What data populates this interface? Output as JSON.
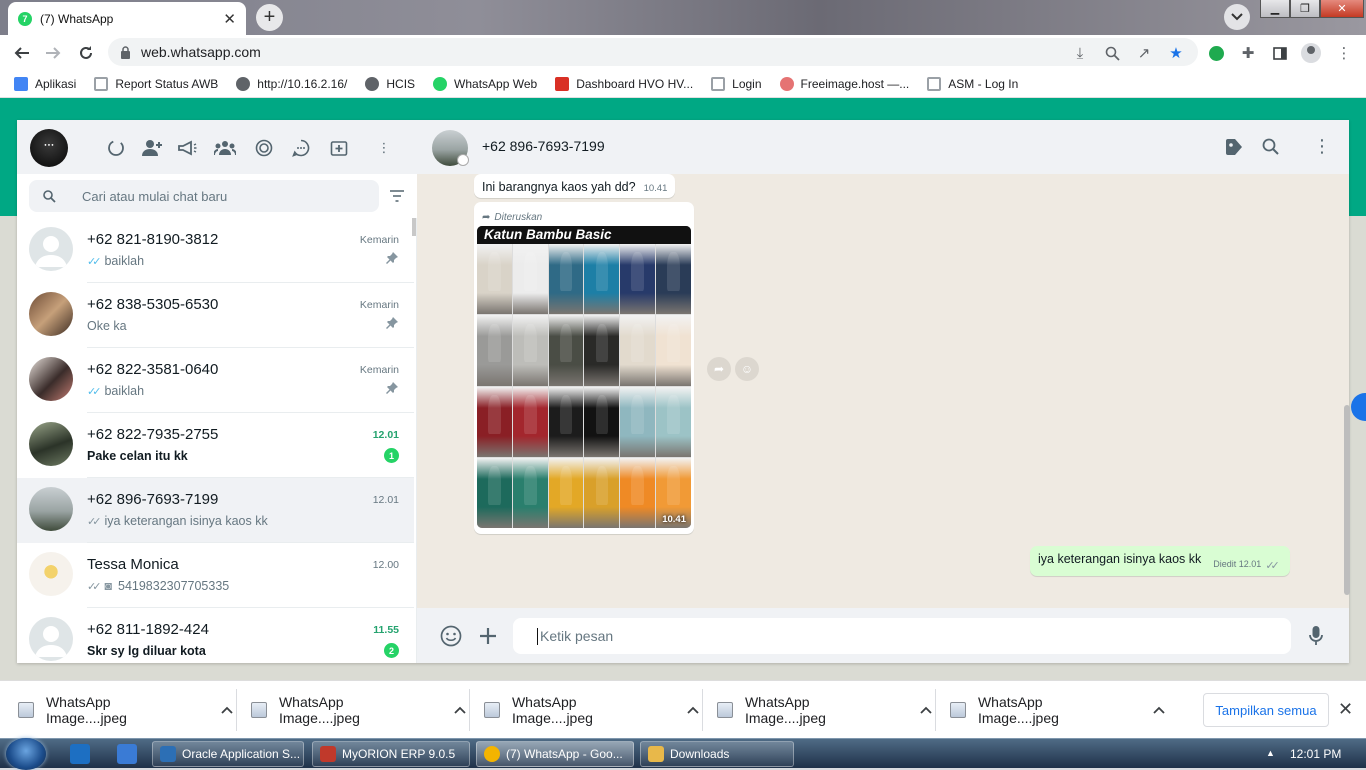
{
  "browser": {
    "tab_title": "(7) WhatsApp",
    "address": "web.whatsapp.com",
    "bookmarks": [
      {
        "label": "Aplikasi",
        "icon": "apps-grid-icon",
        "color": "#4285f4"
      },
      {
        "label": "Report Status AWB",
        "icon": "page-icon",
        "color": "#9aa0a6"
      },
      {
        "label": "http://10.16.2.16/",
        "icon": "globe-icon",
        "color": "#5f6368"
      },
      {
        "label": "HCIS",
        "icon": "globe-icon",
        "color": "#5f6368"
      },
      {
        "label": "WhatsApp Web",
        "icon": "whatsapp-icon",
        "color": "#25d366"
      },
      {
        "label": "Dashboard HVO HV...",
        "icon": "red-doc-icon",
        "color": "#d93025"
      },
      {
        "label": "Login",
        "icon": "page-icon",
        "color": "#9aa0a6"
      },
      {
        "label": "Freeimage.host —...",
        "icon": "freeimage-icon",
        "color": "#e57373"
      },
      {
        "label": "ASM - Log In",
        "icon": "page-icon",
        "color": "#9aa0a6"
      }
    ]
  },
  "sidebar": {
    "search_placeholder": "Cari atau mulai chat baru",
    "chats": [
      {
        "name": "+62 821-8190-3812",
        "message": "baiklah",
        "time": "Kemarin",
        "tick": "blue",
        "pinned": true,
        "unread": "",
        "bold": false,
        "avatar": "default",
        "selected": false
      },
      {
        "name": "+62 838-5305-6530",
        "message": "Oke ka",
        "time": "Kemarin",
        "tick": "",
        "pinned": true,
        "unread": "",
        "bold": false,
        "avatar": "photo-a",
        "selected": false
      },
      {
        "name": "+62 822-3581-0640",
        "message": "baiklah",
        "time": "Kemarin",
        "tick": "blue",
        "pinned": true,
        "unread": "",
        "bold": false,
        "avatar": "photo-b",
        "selected": false
      },
      {
        "name": "+62 822-7935-2755",
        "message": "Pake celan itu kk",
        "time": "12.01",
        "tick": "",
        "pinned": false,
        "unread": "1",
        "bold": true,
        "avatar": "photo-c",
        "selected": false
      },
      {
        "name": "+62 896-7693-7199",
        "message": "iya keterangan isinya kaos kk",
        "time": "12.01",
        "tick": "grey",
        "pinned": false,
        "unread": "",
        "bold": false,
        "avatar": "photo-d",
        "selected": true
      },
      {
        "name": "Tessa Monica",
        "message": "5419832307705335",
        "time": "12.00",
        "tick": "grey",
        "pinned": false,
        "unread": "",
        "bold": false,
        "avatar": "photo-e",
        "selected": false,
        "camera": true
      },
      {
        "name": "+62 811-1892-424",
        "message": "Skr sy lg diluar kota",
        "time": "11.55",
        "tick": "",
        "pinned": false,
        "unread": "2",
        "bold": true,
        "avatar": "default",
        "selected": false
      }
    ]
  },
  "conversation": {
    "contact_name": "+62 896-7693-7199",
    "incoming_text": "Ini barangnya kaos yah dd?",
    "incoming_time": "10.41",
    "forwarded_label": "Diteruskan",
    "image_title": "Katun Bambu Basic",
    "image_time": "10.41",
    "outgoing_text": "iya keterangan isinya kaos kk",
    "outgoing_meta": "Diedit 12.01",
    "input_placeholder": "Ketik pesan",
    "shirt_colors": [
      "#d9d3c8",
      "#ececec",
      "#2f6a86",
      "#1d7fa6",
      "#273a6a",
      "#2a3c57",
      "#9a9a98",
      "#bdbdb9",
      "#4a4d45",
      "#2a2a28",
      "#e2dacd",
      "#f0e2d2",
      "#8a1f25",
      "#a3262d",
      "#1c1c1c",
      "#121212",
      "#8fb7bf",
      "#9cc3c6",
      "#1d6a5c",
      "#2a7f6d",
      "#e3a826",
      "#d9a02a",
      "#ef8a25",
      "#f19a36"
    ]
  },
  "downloads": {
    "items": [
      "WhatsApp Image....jpeg",
      "WhatsApp Image....jpeg",
      "WhatsApp Image....jpeg",
      "WhatsApp Image....jpeg",
      "WhatsApp Image....jpeg"
    ],
    "show_all": "Tampilkan semua"
  },
  "taskbar": {
    "items": [
      {
        "label": "Oracle Application S...",
        "color": "#2c6fb5"
      },
      {
        "label": "MyORION ERP 9.0.5",
        "color": "#c0392b"
      },
      {
        "label": "(7) WhatsApp - Goo...",
        "color": "#f4b400"
      },
      {
        "label": "Downloads",
        "color": "#e8b84a"
      }
    ],
    "clock": "12:01 PM"
  }
}
